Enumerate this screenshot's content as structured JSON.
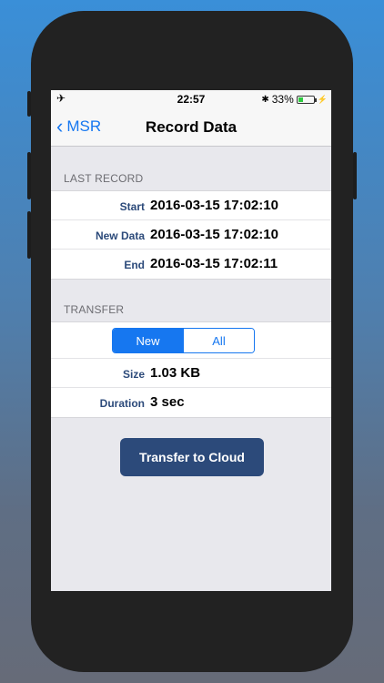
{
  "status_bar": {
    "airplane_icon": "✈",
    "time": "22:57",
    "bluetooth_icon": "✱",
    "battery_percent": "33%",
    "battery_level": 0.33,
    "charging_icon": "⚡"
  },
  "nav": {
    "back_label": "MSR",
    "title": "Record Data"
  },
  "last_record": {
    "header": "LAST RECORD",
    "rows": [
      {
        "label": "Start",
        "value": "2016-03-15  17:02:10"
      },
      {
        "label": "New Data",
        "value": "2016-03-15  17:02:10"
      },
      {
        "label": "End",
        "value": "2016-03-15  17:02:11"
      }
    ]
  },
  "transfer": {
    "header": "TRANSFER",
    "segments": [
      "New",
      "All"
    ],
    "selected_segment": "New",
    "rows": [
      {
        "label": "Size",
        "value": "1.03 KB"
      },
      {
        "label": "Duration",
        "value": "3 sec"
      }
    ],
    "button_label": "Transfer to Cloud"
  },
  "colors": {
    "accent": "#1677f0",
    "button": "#2c4a7a",
    "label": "#2c4a7a"
  }
}
